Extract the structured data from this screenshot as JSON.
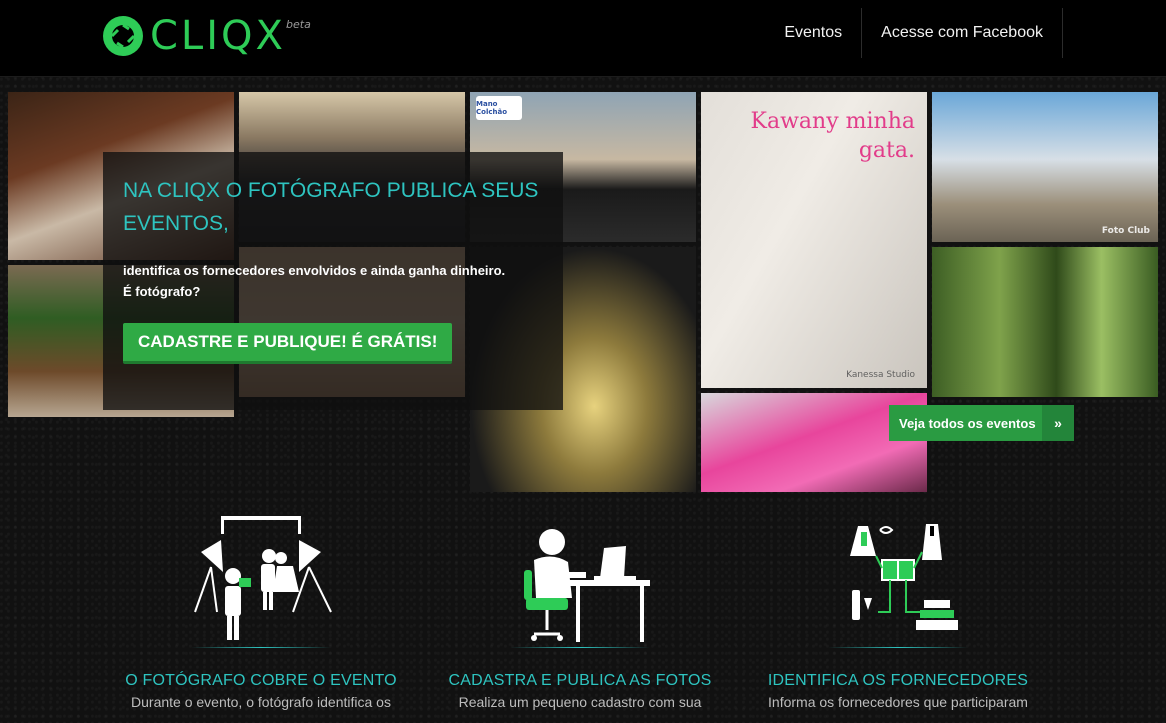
{
  "header": {
    "logo_text": "CLIQX",
    "beta_label": "beta",
    "nav": [
      {
        "label": "Eventos"
      },
      {
        "label": "Acesse com Facebook"
      }
    ]
  },
  "gallery": {
    "tile2_badge": "Mano Colchão",
    "tile4_caption": "Kawany minha gata.",
    "tile4_watermark": "Kanessa Studio",
    "tile5_watermark": "Foto Club"
  },
  "hero": {
    "title": "NA CLIQX O FOTÓGRAFO PUBLICA SEUS EVENTOS,",
    "line1": "identifica os fornecedores envolvidos e ainda ganha dinheiro.",
    "line2": "É fotógrafo?",
    "cta_label": "CADASTRE E PUBLIQUE! É GRÁTIS!"
  },
  "events_button": {
    "label": "Veja todos os eventos",
    "arrow": "»"
  },
  "features": [
    {
      "title": "O FOTÓGRAFO COBRE O EVENTO",
      "text": "Durante o evento, o fotógrafo identifica os"
    },
    {
      "title": "CADASTRA E PUBLICA AS FOTOS",
      "text": "Realiza um pequeno cadastro com sua"
    },
    {
      "title": "IDENTIFICA OS FORNECEDORES",
      "text": "Informa os fornecedores que participaram"
    }
  ],
  "colors": {
    "brand_green": "#2ecc57",
    "accent_teal": "#2ec4c0",
    "button_green": "#2faa45"
  }
}
